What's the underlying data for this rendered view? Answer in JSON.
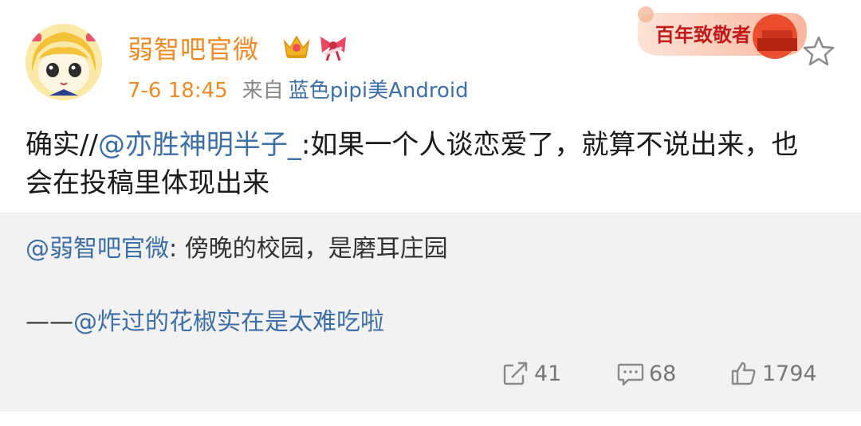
{
  "post": {
    "username": "弱智吧官微",
    "time": "7-6 18:45",
    "from_label": "来自",
    "source": "蓝色pipi美Android",
    "text_prefix": "确实//",
    "text_mention": "@亦胜神明半子_",
    "text_rest": ":如果一个人谈恋爱了，就算不说出来，也会在投稿里体现出来"
  },
  "promo": {
    "label": "百年致敬者"
  },
  "repost": {
    "mention1": "@弱智吧官微",
    "text1": ": 傍晚的校园，是磨耳庄园",
    "dash": "——",
    "mention2": "@炸过的花椒实在是太难吃啦"
  },
  "actions": {
    "share_count": "41",
    "comment_count": "68",
    "like_count": "1794"
  },
  "colors": {
    "accent_orange": "#f08a24",
    "link_blue": "#3d6fa6",
    "repost_bg": "#f2f2f2"
  },
  "icons": [
    "avatar-cartoon",
    "crown-icon",
    "bow-icon",
    "promo-badge",
    "star-icon",
    "share-icon",
    "comment-icon",
    "like-icon"
  ]
}
